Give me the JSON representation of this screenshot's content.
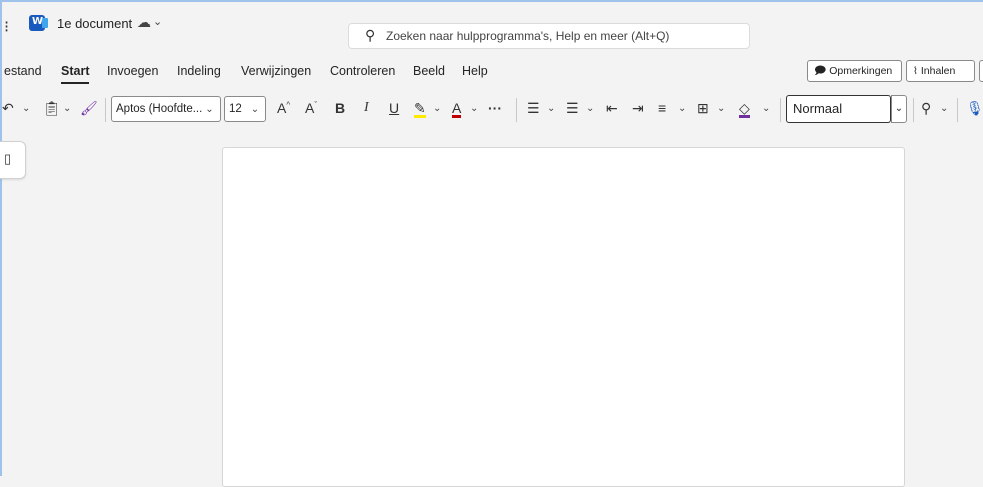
{
  "titlebar": {
    "doc_title": "1e document",
    "save_icon": "cloud-sync-icon",
    "caret": "⌄"
  },
  "search": {
    "placeholder": "Zoeken naar hulpprogramma's, Help en meer (Alt+Q)"
  },
  "menu": {
    "tabs": [
      {
        "label": "estand"
      },
      {
        "label": "Start",
        "active": true
      },
      {
        "label": "Invoegen"
      },
      {
        "label": "Indeling"
      },
      {
        "label": "Verwijzingen"
      },
      {
        "label": "Controleren"
      },
      {
        "label": "Beeld"
      },
      {
        "label": "Help"
      }
    ],
    "comments_label": "Opmerkingen",
    "catchup_label": "Inhalen"
  },
  "ribbon": {
    "font_name": "Aptos (Hoofdte...",
    "font_size": "12",
    "grow_font": "A",
    "shrink_font": "A",
    "bold": "B",
    "italic": "I",
    "underline": "U",
    "font_color_label": "A",
    "more": "···",
    "style_value": "Normaal",
    "highlight_color": "#ffea00",
    "font_color": "#c00000"
  },
  "colors": {
    "accent_border": "#9ec2ea",
    "word_blue": "#185abd"
  }
}
